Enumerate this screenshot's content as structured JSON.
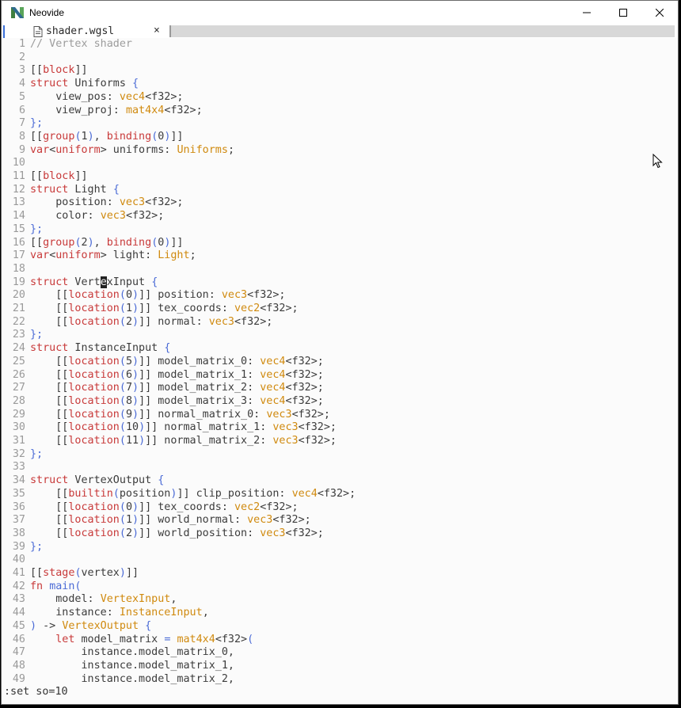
{
  "window": {
    "title": "Neovide"
  },
  "tab": {
    "filename": "shader.wgsl",
    "close": "×"
  },
  "colors": {
    "comment": "#9c9c9c",
    "attribute": "#c83a3a",
    "keyword": "#c83a3a",
    "type": "#d08a0f",
    "punct": "#4b6bd6",
    "text": "#3c3c3c"
  },
  "cursor": {
    "line": 19,
    "column": 13
  },
  "lines": [
    [
      [
        "cm",
        "// Vertex shader"
      ]
    ],
    [],
    [
      [
        "tx",
        "[["
      ],
      [
        "at",
        "block"
      ],
      [
        "tx",
        "]]"
      ]
    ],
    [
      [
        "kw",
        "struct"
      ],
      [
        "tx",
        " Uniforms "
      ],
      [
        "pu",
        "{"
      ]
    ],
    [
      [
        "tx",
        "    view_pos: "
      ],
      [
        "ty",
        "vec4"
      ],
      [
        "tx",
        "<f32>;"
      ]
    ],
    [
      [
        "tx",
        "    view_proj: "
      ],
      [
        "ty",
        "mat4x4"
      ],
      [
        "tx",
        "<f32>;"
      ]
    ],
    [
      [
        "pu",
        "};"
      ]
    ],
    [
      [
        "tx",
        "[["
      ],
      [
        "at",
        "group"
      ],
      [
        "pu",
        "("
      ],
      [
        "tx",
        "1"
      ],
      [
        "pu",
        ")"
      ],
      [
        "tx",
        ", "
      ],
      [
        "at",
        "binding"
      ],
      [
        "pu",
        "("
      ],
      [
        "tx",
        "0"
      ],
      [
        "pu",
        ")"
      ],
      [
        "tx",
        "]]"
      ]
    ],
    [
      [
        "kw",
        "var"
      ],
      [
        "tx",
        "<"
      ],
      [
        "kw",
        "uniform"
      ],
      [
        "tx",
        "> uniforms: "
      ],
      [
        "ty",
        "Uniforms"
      ],
      [
        "tx",
        ";"
      ]
    ],
    [],
    [
      [
        "tx",
        "[["
      ],
      [
        "at",
        "block"
      ],
      [
        "tx",
        "]]"
      ]
    ],
    [
      [
        "kw",
        "struct"
      ],
      [
        "tx",
        " Light "
      ],
      [
        "pu",
        "{"
      ]
    ],
    [
      [
        "tx",
        "    position: "
      ],
      [
        "ty",
        "vec3"
      ],
      [
        "tx",
        "<f32>;"
      ]
    ],
    [
      [
        "tx",
        "    color: "
      ],
      [
        "ty",
        "vec3"
      ],
      [
        "tx",
        "<f32>;"
      ]
    ],
    [
      [
        "pu",
        "};"
      ]
    ],
    [
      [
        "tx",
        "[["
      ],
      [
        "at",
        "group"
      ],
      [
        "pu",
        "("
      ],
      [
        "tx",
        "2"
      ],
      [
        "pu",
        ")"
      ],
      [
        "tx",
        ", "
      ],
      [
        "at",
        "binding"
      ],
      [
        "pu",
        "("
      ],
      [
        "tx",
        "0"
      ],
      [
        "pu",
        ")"
      ],
      [
        "tx",
        "]]"
      ]
    ],
    [
      [
        "kw",
        "var"
      ],
      [
        "tx",
        "<"
      ],
      [
        "kw",
        "uniform"
      ],
      [
        "tx",
        "> light: "
      ],
      [
        "ty",
        "Light"
      ],
      [
        "tx",
        ";"
      ]
    ],
    [],
    [
      [
        "kw",
        "struct"
      ],
      [
        "tx",
        " Vert"
      ],
      [
        "cursor",
        "e"
      ],
      [
        "tx",
        "xInput "
      ],
      [
        "pu",
        "{"
      ]
    ],
    [
      [
        "tx",
        "    [["
      ],
      [
        "at",
        "location"
      ],
      [
        "pu",
        "("
      ],
      [
        "tx",
        "0"
      ],
      [
        "pu",
        ")"
      ],
      [
        "tx",
        "]] position: "
      ],
      [
        "ty",
        "vec3"
      ],
      [
        "tx",
        "<f32>;"
      ]
    ],
    [
      [
        "tx",
        "    [["
      ],
      [
        "at",
        "location"
      ],
      [
        "pu",
        "("
      ],
      [
        "tx",
        "1"
      ],
      [
        "pu",
        ")"
      ],
      [
        "tx",
        "]] tex_coords: "
      ],
      [
        "ty",
        "vec2"
      ],
      [
        "tx",
        "<f32>;"
      ]
    ],
    [
      [
        "tx",
        "    [["
      ],
      [
        "at",
        "location"
      ],
      [
        "pu",
        "("
      ],
      [
        "tx",
        "2"
      ],
      [
        "pu",
        ")"
      ],
      [
        "tx",
        "]] normal: "
      ],
      [
        "ty",
        "vec3"
      ],
      [
        "tx",
        "<f32>;"
      ]
    ],
    [
      [
        "pu",
        "};"
      ]
    ],
    [
      [
        "kw",
        "struct"
      ],
      [
        "tx",
        " InstanceInput "
      ],
      [
        "pu",
        "{"
      ]
    ],
    [
      [
        "tx",
        "    [["
      ],
      [
        "at",
        "location"
      ],
      [
        "pu",
        "("
      ],
      [
        "tx",
        "5"
      ],
      [
        "pu",
        ")"
      ],
      [
        "tx",
        "]] model_matrix_0: "
      ],
      [
        "ty",
        "vec4"
      ],
      [
        "tx",
        "<f32>;"
      ]
    ],
    [
      [
        "tx",
        "    [["
      ],
      [
        "at",
        "location"
      ],
      [
        "pu",
        "("
      ],
      [
        "tx",
        "6"
      ],
      [
        "pu",
        ")"
      ],
      [
        "tx",
        "]] model_matrix_1: "
      ],
      [
        "ty",
        "vec4"
      ],
      [
        "tx",
        "<f32>;"
      ]
    ],
    [
      [
        "tx",
        "    [["
      ],
      [
        "at",
        "location"
      ],
      [
        "pu",
        "("
      ],
      [
        "tx",
        "7"
      ],
      [
        "pu",
        ")"
      ],
      [
        "tx",
        "]] model_matrix_2: "
      ],
      [
        "ty",
        "vec4"
      ],
      [
        "tx",
        "<f32>;"
      ]
    ],
    [
      [
        "tx",
        "    [["
      ],
      [
        "at",
        "location"
      ],
      [
        "pu",
        "("
      ],
      [
        "tx",
        "8"
      ],
      [
        "pu",
        ")"
      ],
      [
        "tx",
        "]] model_matrix_3: "
      ],
      [
        "ty",
        "vec4"
      ],
      [
        "tx",
        "<f32>;"
      ]
    ],
    [
      [
        "tx",
        "    [["
      ],
      [
        "at",
        "location"
      ],
      [
        "pu",
        "("
      ],
      [
        "tx",
        "9"
      ],
      [
        "pu",
        ")"
      ],
      [
        "tx",
        "]] normal_matrix_0: "
      ],
      [
        "ty",
        "vec3"
      ],
      [
        "tx",
        "<f32>;"
      ]
    ],
    [
      [
        "tx",
        "    [["
      ],
      [
        "at",
        "location"
      ],
      [
        "pu",
        "("
      ],
      [
        "tx",
        "10"
      ],
      [
        "pu",
        ")"
      ],
      [
        "tx",
        "]] normal_matrix_1: "
      ],
      [
        "ty",
        "vec3"
      ],
      [
        "tx",
        "<f32>;"
      ]
    ],
    [
      [
        "tx",
        "    [["
      ],
      [
        "at",
        "location"
      ],
      [
        "pu",
        "("
      ],
      [
        "tx",
        "11"
      ],
      [
        "pu",
        ")"
      ],
      [
        "tx",
        "]] normal_matrix_2: "
      ],
      [
        "ty",
        "vec3"
      ],
      [
        "tx",
        "<f32>;"
      ]
    ],
    [
      [
        "pu",
        "};"
      ]
    ],
    [],
    [
      [
        "kw",
        "struct"
      ],
      [
        "tx",
        " VertexOutput "
      ],
      [
        "pu",
        "{"
      ]
    ],
    [
      [
        "tx",
        "    [["
      ],
      [
        "at",
        "builtin"
      ],
      [
        "pu",
        "("
      ],
      [
        "tx",
        "position"
      ],
      [
        "pu",
        ")"
      ],
      [
        "tx",
        "]] clip_position: "
      ],
      [
        "ty",
        "vec4"
      ],
      [
        "tx",
        "<f32>;"
      ]
    ],
    [
      [
        "tx",
        "    [["
      ],
      [
        "at",
        "location"
      ],
      [
        "pu",
        "("
      ],
      [
        "tx",
        "0"
      ],
      [
        "pu",
        ")"
      ],
      [
        "tx",
        "]] tex_coords: "
      ],
      [
        "ty",
        "vec2"
      ],
      [
        "tx",
        "<f32>;"
      ]
    ],
    [
      [
        "tx",
        "    [["
      ],
      [
        "at",
        "location"
      ],
      [
        "pu",
        "("
      ],
      [
        "tx",
        "1"
      ],
      [
        "pu",
        ")"
      ],
      [
        "tx",
        "]] world_normal: "
      ],
      [
        "ty",
        "vec3"
      ],
      [
        "tx",
        "<f32>;"
      ]
    ],
    [
      [
        "tx",
        "    [["
      ],
      [
        "at",
        "location"
      ],
      [
        "pu",
        "("
      ],
      [
        "tx",
        "2"
      ],
      [
        "pu",
        ")"
      ],
      [
        "tx",
        "]] world_position: "
      ],
      [
        "ty",
        "vec3"
      ],
      [
        "tx",
        "<f32>;"
      ]
    ],
    [
      [
        "pu",
        "};"
      ]
    ],
    [],
    [
      [
        "tx",
        "[["
      ],
      [
        "at",
        "stage"
      ],
      [
        "pu",
        "("
      ],
      [
        "tx",
        "vertex"
      ],
      [
        "pu",
        ")"
      ],
      [
        "tx",
        "]]"
      ]
    ],
    [
      [
        "kw",
        "fn"
      ],
      [
        "tx",
        " "
      ],
      [
        "pu",
        "main("
      ]
    ],
    [
      [
        "tx",
        "    model: "
      ],
      [
        "ty",
        "VertexInput"
      ],
      [
        "tx",
        ","
      ]
    ],
    [
      [
        "tx",
        "    instance: "
      ],
      [
        "ty",
        "InstanceInput"
      ],
      [
        "tx",
        ","
      ]
    ],
    [
      [
        "pu",
        ")"
      ],
      [
        "tx",
        " -> "
      ],
      [
        "ty",
        "VertexOutput"
      ],
      [
        "tx",
        " "
      ],
      [
        "pu",
        "{"
      ]
    ],
    [
      [
        "tx",
        "    "
      ],
      [
        "kw",
        "let"
      ],
      [
        "tx",
        " model_matrix "
      ],
      [
        "pu",
        "="
      ],
      [
        "tx",
        " "
      ],
      [
        "ty",
        "mat4x4"
      ],
      [
        "tx",
        "<f32>"
      ],
      [
        "pu",
        "("
      ]
    ],
    [
      [
        "tx",
        "        instance.model_matrix_0,"
      ]
    ],
    [
      [
        "tx",
        "        instance.model_matrix_1,"
      ]
    ],
    [
      [
        "tx",
        "        instance.model_matrix_2,"
      ]
    ]
  ],
  "cmdline": {
    "text": ":set so=10"
  }
}
